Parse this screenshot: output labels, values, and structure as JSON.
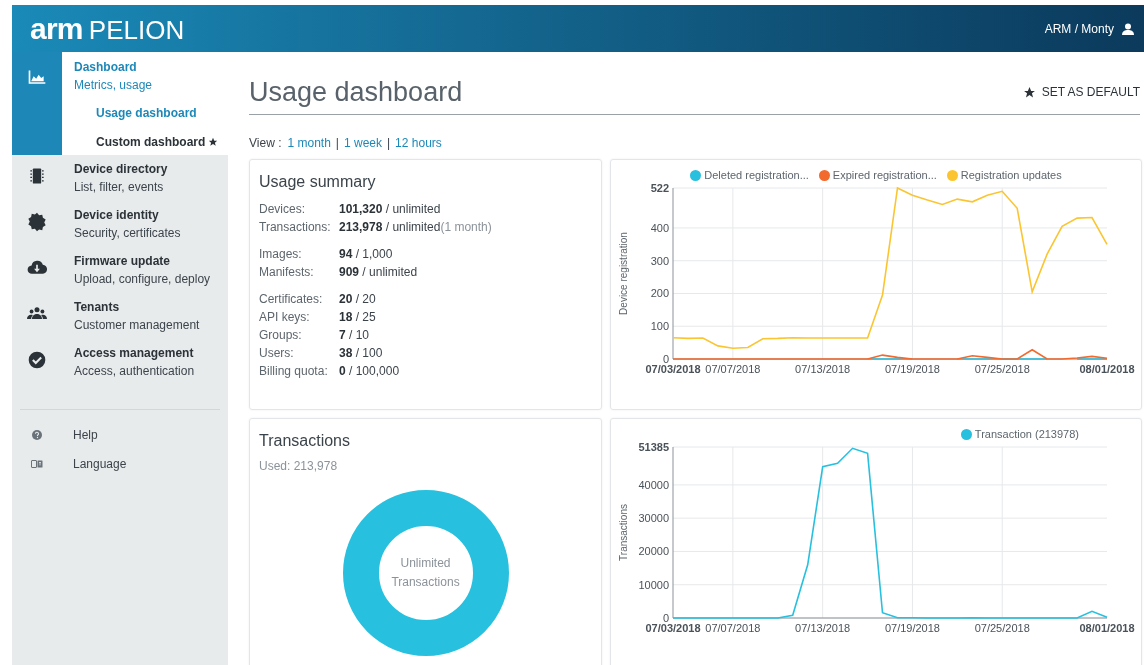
{
  "header": {
    "logo_mark": "arm",
    "logo_text": "PELION",
    "user": "ARM / Monty"
  },
  "sidebar": {
    "items": [
      {
        "title": "Dashboard",
        "subtitle": "Metrics, usage",
        "selected": true,
        "children": [
          {
            "label": "Usage dashboard",
            "selected": true,
            "starred": false
          },
          {
            "label": "Custom dashboard",
            "selected": false,
            "starred": true
          }
        ]
      },
      {
        "title": "Device directory",
        "subtitle": "List, filter, events",
        "selected": false
      },
      {
        "title": "Device identity",
        "subtitle": "Security, certificates",
        "selected": false
      },
      {
        "title": "Firmware update",
        "subtitle": "Upload, configure, deploy",
        "selected": false
      },
      {
        "title": "Tenants",
        "subtitle": "Customer management",
        "selected": false
      },
      {
        "title": "Access management",
        "subtitle": "Access, authentication",
        "selected": false
      }
    ],
    "footer": [
      {
        "label": "Help"
      },
      {
        "label": "Language"
      }
    ]
  },
  "page": {
    "title": "Usage dashboard",
    "set_default": "SET AS DEFAULT",
    "view_label": "View :",
    "views": [
      "1 month",
      "1 week",
      "12 hours"
    ],
    "view_separator": "|"
  },
  "usage_summary": {
    "title": "Usage summary",
    "groups": [
      [
        {
          "label": "Devices:",
          "value": "101,320",
          "limit": " / unlimited"
        },
        {
          "label": "Transactions:",
          "value": "213,978",
          "limit": " / unlimited",
          "note": "(1 month)"
        }
      ],
      [
        {
          "label": "Images:",
          "value": "94",
          "limit": " / 1,000"
        },
        {
          "label": "Manifests:",
          "value": "909",
          "limit": " / unlimited"
        }
      ],
      [
        {
          "label": "Certificates:",
          "value": "20",
          "limit": " / 20"
        },
        {
          "label": "API keys:",
          "value": "18",
          "limit": " / 25"
        },
        {
          "label": "Groups:",
          "value": "7",
          "limit": " / 10"
        },
        {
          "label": "Users:",
          "value": "38",
          "limit": " / 100"
        },
        {
          "label": "Billing quota:",
          "value": "0",
          "limit": " / 100,000"
        }
      ]
    ]
  },
  "registration_chart": {
    "chart_data": {
      "type": "line",
      "ylabel": "Device registration",
      "categories": [
        "07/03/2018",
        null,
        null,
        null,
        "07/07/2018",
        null,
        null,
        null,
        null,
        null,
        "07/13/2018",
        null,
        null,
        null,
        null,
        null,
        "07/19/2018",
        null,
        null,
        null,
        null,
        null,
        "07/25/2018",
        null,
        null,
        null,
        null,
        null,
        null,
        "08/01/2018"
      ],
      "series": [
        {
          "name": "Deleted registration...",
          "color": "#27c0de",
          "values": [
            null,
            null,
            null,
            null,
            null,
            null,
            null,
            null,
            null,
            null,
            null,
            null,
            null,
            0,
            0,
            0,
            0,
            null,
            null,
            0,
            0,
            0,
            0,
            0,
            0,
            0,
            null,
            0,
            0,
            0
          ]
        },
        {
          "name": "Expired registration...",
          "color": "#f26a2e",
          "values": [
            0,
            0,
            0,
            0,
            0,
            0,
            0,
            0,
            0,
            0,
            0,
            0,
            0,
            0,
            12,
            5,
            0,
            0,
            0,
            0,
            10,
            5,
            0,
            0,
            28,
            0,
            0,
            3,
            8,
            2
          ]
        },
        {
          "name": "Registration updates",
          "color": "#fbc531",
          "values": [
            65,
            63,
            64,
            40,
            33,
            35,
            62,
            63,
            65,
            64,
            64,
            64,
            64,
            64,
            195,
            522,
            500,
            485,
            472,
            488,
            480,
            500,
            512,
            460,
            205,
            320,
            405,
            430,
            432,
            350
          ]
        }
      ],
      "ylim": [
        0,
        522
      ],
      "grid": true,
      "legend": true,
      "yticks": [
        0,
        100,
        200,
        300,
        400,
        522
      ]
    }
  },
  "transactions": {
    "title": "Transactions",
    "used": "Used: 213,978",
    "donut_line1": "Unlimited",
    "donut_line2": "Transactions"
  },
  "transactions_chart": {
    "chart_data": {
      "type": "line",
      "ylabel": "Transactions",
      "categories": [
        "07/03/2018",
        null,
        null,
        null,
        "07/07/2018",
        null,
        null,
        null,
        null,
        null,
        "07/13/2018",
        null,
        null,
        null,
        null,
        null,
        "07/19/2018",
        null,
        null,
        null,
        null,
        null,
        "07/25/2018",
        null,
        null,
        null,
        null,
        null,
        null,
        "08/01/2018"
      ],
      "series": [
        {
          "name": "Transaction (213978)",
          "color": "#27c0de",
          "values": [
            0,
            0,
            0,
            0,
            0,
            0,
            0,
            0,
            800,
            16000,
            45500,
            46500,
            51000,
            49500,
            1600,
            100,
            100,
            0,
            0,
            0,
            100,
            0,
            0,
            0,
            0,
            0,
            0,
            0,
            2000,
            200
          ]
        }
      ],
      "ylim": [
        0,
        51385
      ],
      "grid": true,
      "legend": true,
      "yticks": [
        0,
        10000,
        20000,
        30000,
        40000,
        51385
      ]
    }
  }
}
